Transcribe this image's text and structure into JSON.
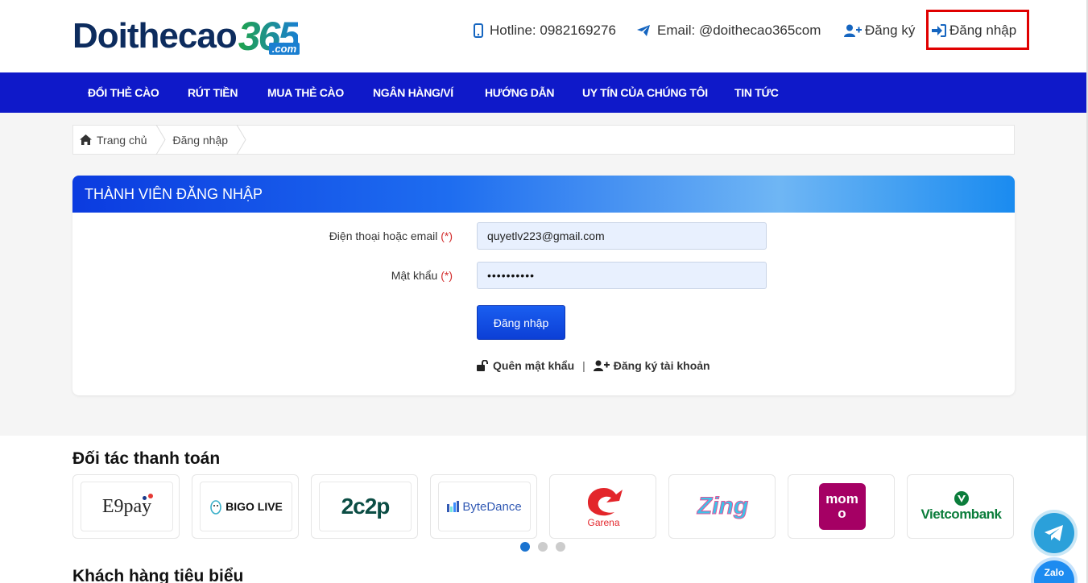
{
  "header": {
    "logo_main": "Doithecao",
    "logo_num": "365",
    "logo_suffix": ".com",
    "hotline": "Hotline: 0982169276",
    "email": "Email: @doithecao365com",
    "register": "Đăng ký",
    "login": "Đăng nhập"
  },
  "nav": [
    "ĐỔI THẺ CÀO",
    "RÚT TIỀN",
    "MUA THẺ CÀO",
    "NGÂN HÀNG/VÍ",
    "HƯỚNG DẪN",
    "UY TÍN CỦA CHÚNG TÔI",
    "TIN TỨC"
  ],
  "breadcrumb": {
    "home": "Trang chủ",
    "current": "Đăng nhập"
  },
  "login_card": {
    "title": "THÀNH VIÊN ĐĂNG NHẬP",
    "phone_label": "Điện thoại hoặc email",
    "password_label": "Mật khẩu",
    "required_mark": "(*)",
    "phone_value": "quyetlv223@gmail.com",
    "password_dots": "••••••••••",
    "submit": "Đăng nhập",
    "forgot": "Quên mật khẩu",
    "separator": "|",
    "register": "Đăng ký tài khoản"
  },
  "partners": {
    "title": "Đối tác thanh toán",
    "items": [
      "E9pay",
      "BIGO LIVE",
      "2C2P",
      "ByteDance",
      "Garena",
      "Zing",
      "momo",
      "Vietcombank"
    ]
  },
  "customers": {
    "title": "Khách hàng tiêu biểu"
  },
  "floating": {
    "zalo": "Zalo"
  },
  "colors": {
    "nav_bg": "#0f19c9",
    "accent": "#1565c0",
    "highlight": "#e00000"
  }
}
